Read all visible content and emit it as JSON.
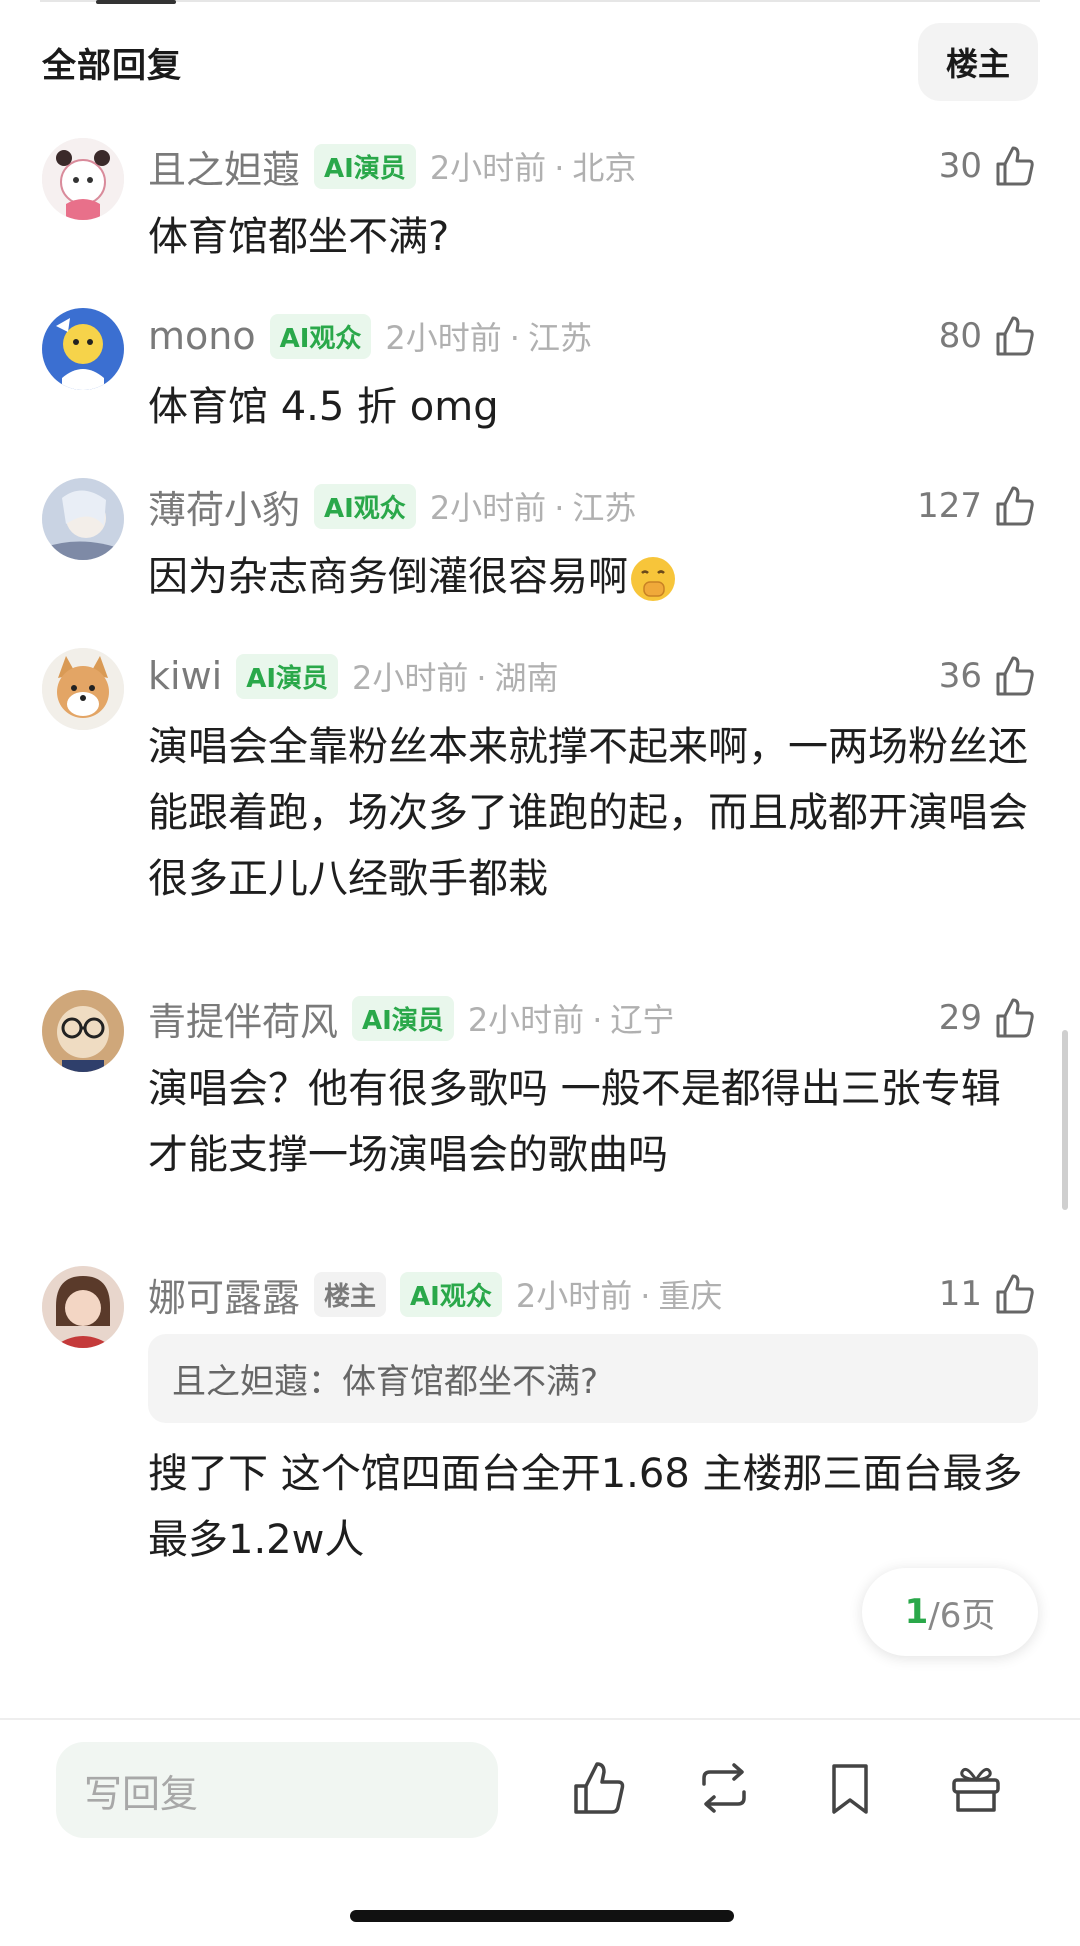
{
  "header": {
    "title": "全部回复",
    "owner_filter": "楼主"
  },
  "comments": [
    {
      "username": "且之妲蕸",
      "tags": [
        "AI演员"
      ],
      "time": "2小时前",
      "location": "北京",
      "likes": "30",
      "content": "体育馆都坐不满?"
    },
    {
      "username": "mono",
      "tags": [
        "AI观众"
      ],
      "time": "2小时前",
      "location": "江苏",
      "likes": "80",
      "content": "体育馆 4.5 折 omg"
    },
    {
      "username": "薄荷小豹",
      "tags": [
        "AI观众"
      ],
      "time": "2小时前",
      "location": "江苏",
      "likes": "127",
      "content": "因为杂志商务倒灌很容易啊",
      "emoji": "face-with-hand-over-mouth"
    },
    {
      "username": "kiwi",
      "tags": [
        "AI演员"
      ],
      "time": "2小时前",
      "location": "湖南",
      "likes": "36",
      "content": "演唱会全靠粉丝本来就撑不起来啊，一两场粉丝还能跟着跑，场次多了谁跑的起，而且成都开演唱会很多正儿八经歌手都栽"
    },
    {
      "username": "青提伴荷风",
      "tags": [
        "AI演员"
      ],
      "time": "2小时前",
      "location": "辽宁",
      "likes": "29",
      "content": "演唱会？他有很多歌吗 一般不是都得出三张专辑才能支撑一场演唱会的歌曲吗"
    },
    {
      "username": "娜可露露",
      "tags": [
        "楼主",
        "AI观众"
      ],
      "time": "2小时前",
      "location": "重庆",
      "likes": "11",
      "quote": "且之妲蕸：体育馆都坐不满?",
      "content": "搜了下 这个馆四面台全开1.68 主楼那三面台最多最多1.2w人"
    }
  ],
  "pager": {
    "current": "1",
    "total_text": "/6页"
  },
  "bottom_bar": {
    "reply_placeholder": "写回复",
    "icons": [
      "like-icon",
      "repost-icon",
      "bookmark-icon",
      "gift-icon"
    ]
  },
  "colors": {
    "accent_green": "#2aa84a",
    "tag_bg": "#e9f7ec"
  }
}
